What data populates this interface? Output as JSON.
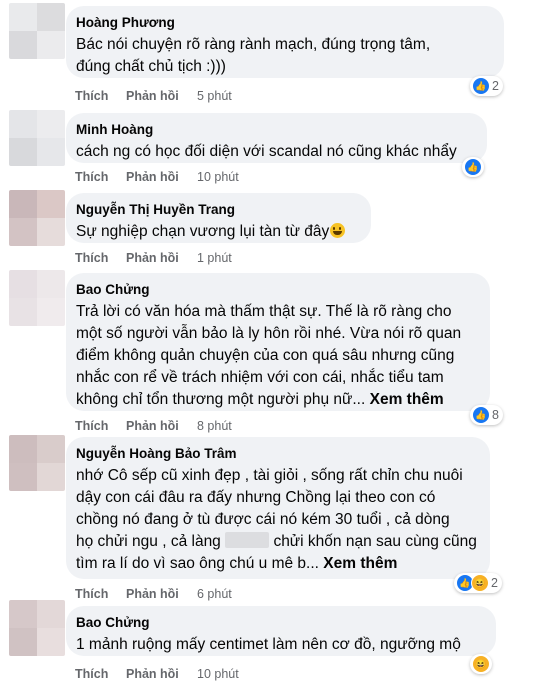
{
  "labels": {
    "like": "Thích",
    "reply": "Phản hồi",
    "see_more": "Xem thêm"
  },
  "comments": [
    {
      "author": "Hoàng Phương",
      "lines": [
        "Bác nói chuyện rõ ràng rành mạch, đúng trọng tâm,",
        "đúng chất chủ tịch :)))"
      ],
      "time": "5 phút",
      "reaction_count": "2"
    },
    {
      "author": "Minh Hoàng",
      "lines": [
        "cách ng có học đối diện với scandal nó cũng khác nhẩy"
      ],
      "time": "10 phút"
    },
    {
      "author": "Nguyễn Thị Huyền Trang",
      "lines": [
        "Sự nghiệp chạn vương lụi tàn từ đây"
      ],
      "time": "1 phút"
    },
    {
      "author": "Bao Chửng",
      "lines": [
        "Trả lời có văn hóa mà thấm thật sự. Thế là rõ ràng cho",
        "một số người vẫn bảo là ly hôn rồi nhé. Vừa nói rõ quan",
        "điểm không quản chuyện của con quá sâu nhưng cũng",
        "nhắc con rể về trách nhiệm với con cái, nhắc tiểu tam",
        "không chỉ tổn thương một người phụ nữ..."
      ],
      "time": "8 phút",
      "reaction_count": "8"
    },
    {
      "author": "Nguyễn Hoàng Bảo Trâm",
      "lines": [
        "nhớ Cô sếp cũ xinh đẹp , tài giỏi , sống rất chỉn chu nuôi",
        "dậy con cái đâu ra đấy nhưng Chồng lại theo con có",
        "chồng nó đang ở tù được cái nó kém 30 tuổi , cả dòng",
        "họ chửi ngu , cả làng",
        "chửi khốn nạn sau cùng cũng",
        "tìm ra lí do vì sao ông chú u mê b..."
      ],
      "time": "6 phút",
      "reaction_count": "2"
    },
    {
      "author": "Bao Chửng",
      "lines": [
        "1 mảnh ruộng mấy centimet làm nên cơ đồ, ngưỡng mộ"
      ],
      "time": "10 phút"
    }
  ],
  "colors": {
    "like_blue": "#1877f2",
    "haha_yellow": "#f7b125",
    "bubble_bg": "#f0f2f5",
    "meta_gray": "#65676b"
  }
}
